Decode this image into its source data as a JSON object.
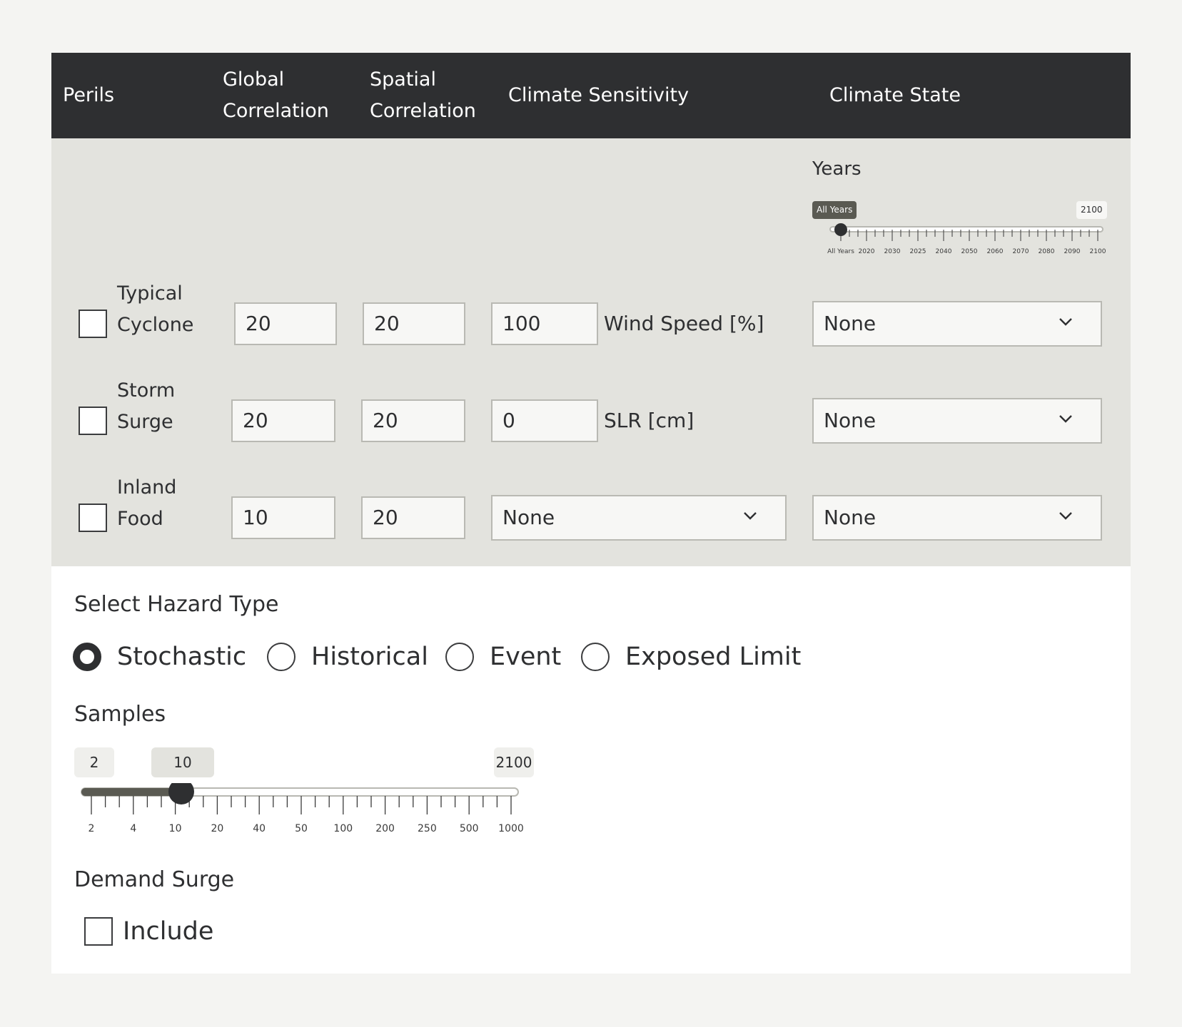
{
  "header": {
    "perils": "Perils",
    "global_correlation_line1": "Global",
    "global_correlation_line2": "Correlation",
    "spatial_correlation_line1": "Spatial",
    "spatial_correlation_line2": "Correlation",
    "climate_sensitivity": "Climate Sensitivity",
    "climate_state": "Climate State"
  },
  "years_slider": {
    "label": "Years",
    "current_value": "All Years",
    "max_value": "2100",
    "tick_labels": [
      "All Years",
      "2020",
      "2030",
      "2025",
      "2040",
      "2050",
      "2060",
      "2070",
      "2080",
      "2090",
      "2100"
    ]
  },
  "perils": [
    {
      "name_line1": "Typical",
      "name_line2": "Cyclone",
      "checked": false,
      "global_correlation": "20",
      "spatial_correlation": "20",
      "sensitivity_value": "100",
      "sensitivity_unit": "Wind Speed [%]",
      "climate_state": "None"
    },
    {
      "name_line1": "Storm",
      "name_line2": "Surge",
      "checked": false,
      "global_correlation": "20",
      "spatial_correlation": "20",
      "sensitivity_value": "0",
      "sensitivity_unit": "SLR [cm]",
      "climate_state": "None"
    },
    {
      "name_line1": "Inland",
      "name_line2": "Food",
      "checked": false,
      "global_correlation": "10",
      "spatial_correlation": "20",
      "sensitivity_select": "None",
      "climate_state": "None"
    }
  ],
  "hazard": {
    "title": "Select Hazard Type",
    "options": [
      "Stochastic",
      "Historical",
      "Event",
      "Exposed Limit"
    ],
    "selected": "Stochastic"
  },
  "samples": {
    "title": "Samples",
    "min_value": "2",
    "current_value": "10",
    "max_value": "2100",
    "tick_labels": [
      "2",
      "4",
      "10",
      "20",
      "40",
      "50",
      "100",
      "200",
      "250",
      "500",
      "1000"
    ]
  },
  "demand_surge": {
    "title": "Demand Surge",
    "include_label": "Include",
    "checked": false
  },
  "colors": {
    "header_bg": "#2e2f31",
    "panel_grey": "#e3e3de",
    "accent_dark": "#2e2f31"
  }
}
